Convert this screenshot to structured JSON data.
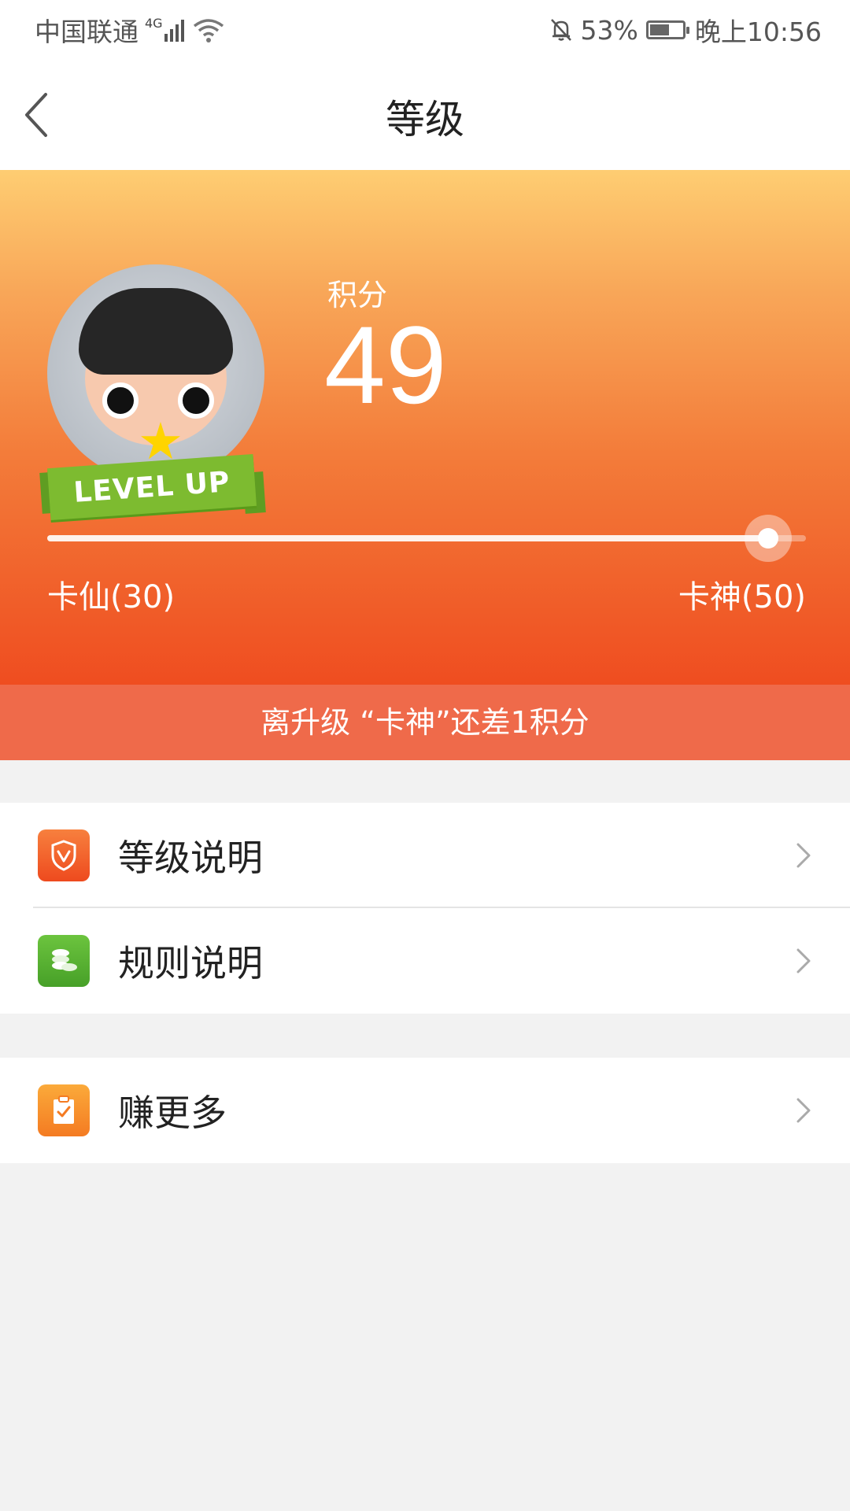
{
  "status_bar": {
    "carrier": "中国联通",
    "network": "4G",
    "battery": "53%",
    "time": "晚上10:56"
  },
  "header": {
    "title": "等级"
  },
  "hero": {
    "points_label": "积分",
    "points_value": "49",
    "progress_fraction": 0.95,
    "level_current": "卡仙(30)",
    "level_next": "卡神(50)",
    "avatar_banner": "LEVEL UP",
    "upgrade_notice": "离升级 “卡神”还差1积分"
  },
  "menu": {
    "items": [
      {
        "label": "等级说明",
        "icon": "shield-icon",
        "color": "#f0582a"
      },
      {
        "label": "规则说明",
        "icon": "coins-icon",
        "color": "#5bb534"
      },
      {
        "label": "赚更多",
        "icon": "clipboard-icon",
        "color": "#f7882c"
      }
    ]
  },
  "colors": {
    "hero_top": "#fecd72",
    "hero_bottom": "#ef4d20",
    "notice_bar": "#ef6a4a",
    "page_bg": "#f2f2f2"
  }
}
